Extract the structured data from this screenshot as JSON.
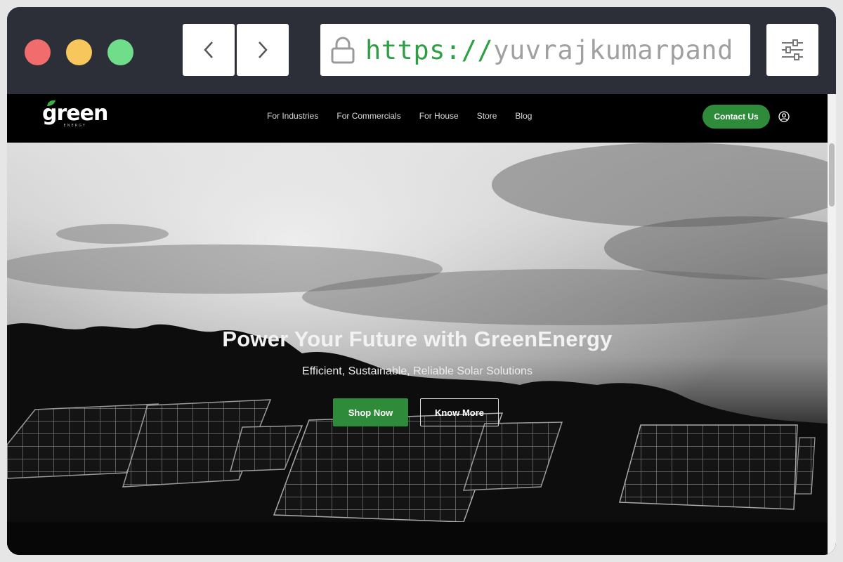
{
  "browser": {
    "url_scheme": "https://",
    "url_host": "yuvrajkumarpand",
    "back_icon": "chevron-left-icon",
    "forward_icon": "chevron-right-icon",
    "lock_icon": "lock-icon",
    "settings_icon": "sliders-icon"
  },
  "site": {
    "logo_text": "green",
    "logo_subtext": "ENERGY",
    "nav": [
      {
        "label": "For Industries"
      },
      {
        "label": "For Commercials"
      },
      {
        "label": "For House"
      },
      {
        "label": "Store"
      },
      {
        "label": "Blog"
      }
    ],
    "contact_label": "Contact Us",
    "user_icon": "user-circle-icon"
  },
  "hero": {
    "title": "Power Your Future with GreenEnergy",
    "subtitle": "Efficient, Sustainable, Reliable Solar Solutions",
    "primary_cta": "Shop Now",
    "secondary_cta": "Know More"
  },
  "colors": {
    "chrome_bg": "#2c2f37",
    "accent_green": "#2e8b3a",
    "url_scheme_color": "#2ea043"
  }
}
